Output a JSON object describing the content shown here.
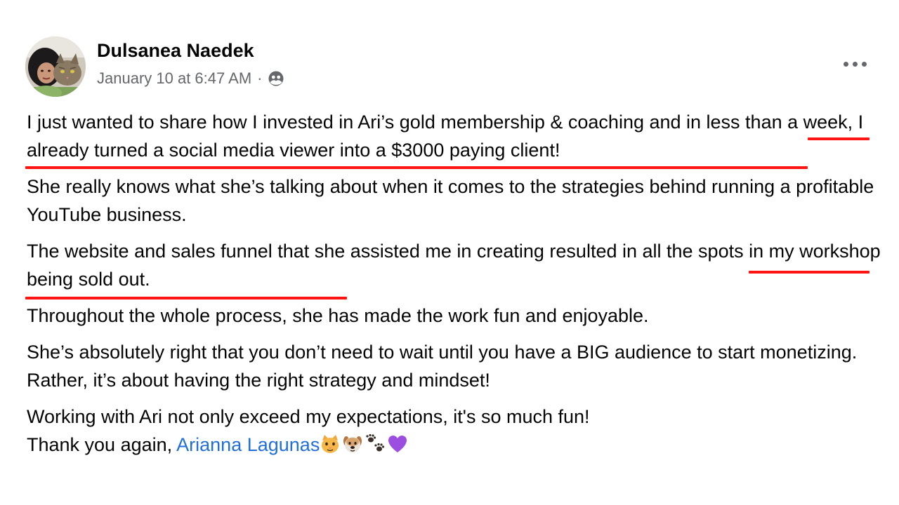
{
  "post": {
    "author": "Dulsanea Naedek",
    "timestamp": "January 10 at 6:47 AM",
    "separator": "·",
    "audience_icon": "friends-icon",
    "more_icon": "more-horizontal-icon",
    "paragraphs": [
      "I just wanted to share how I invested in Ari’s gold membership & coaching and in less than a week, I already turned a social media viewer into a $3000 paying client!",
      "She really knows what she’s talking about when it comes to the strategies behind running a profitable YouTube business.",
      "The website and sales funnel that she assisted me in creating resulted in all the spots in my workshop being sold out.",
      "Throughout the whole process, she has made the work fun and enjoyable.",
      "She’s absolutely right that you don’t need to wait until you have a BIG audience to start monetizing.  Rather, it’s about having the right strategy and mindset!"
    ],
    "closing_line_1": "Working with Ari not only exceed my expectations, it's so much fun!",
    "closing_line_2_prefix": "Thank you again, ",
    "mention": "Arianna Lagunas",
    "emojis": [
      "cat-face-emoji",
      "dog-face-emoji",
      "paw-prints-emoji",
      "purple-heart-emoji"
    ]
  },
  "colors": {
    "text": "#050505",
    "secondary": "#65676b",
    "link": "#216fdb",
    "highlight_underline": "#ff1414"
  }
}
